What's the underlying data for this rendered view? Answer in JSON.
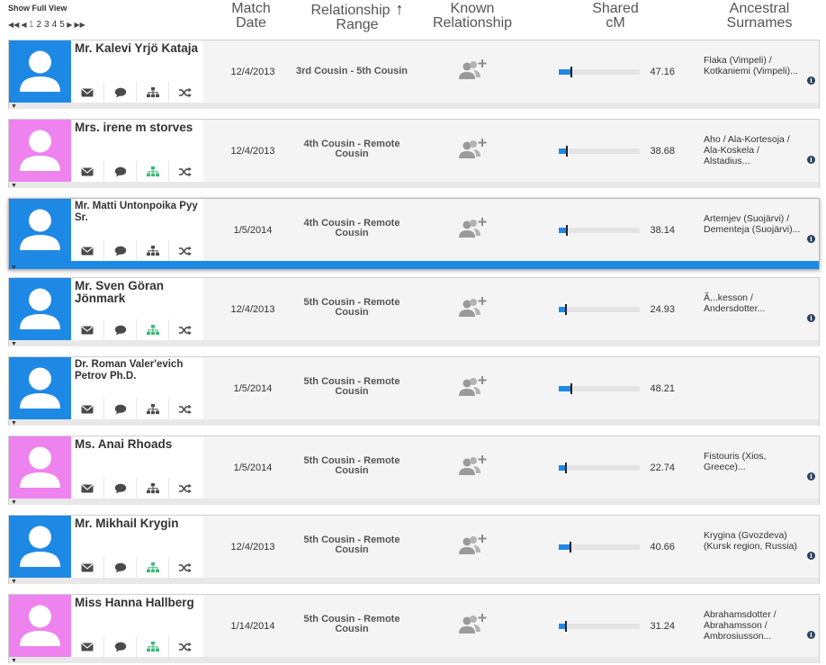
{
  "header": {
    "show_full_view": "Show Full View",
    "pager": {
      "first": "◀◀",
      "prev": "◀",
      "pages": [
        "1",
        "2",
        "3",
        "4",
        "5"
      ],
      "current": "1",
      "next": "▶",
      "last": "▶▶"
    },
    "columns": {
      "match_date": [
        "Match",
        "Date"
      ],
      "relationship_range": [
        "Relationship",
        "Range"
      ],
      "sort_arrow": "↑",
      "known_relationship": [
        "Known",
        "Relationship"
      ],
      "shared_cm": [
        "Shared",
        "cM"
      ],
      "ancestral_surnames": [
        "Ancestral",
        "Surnames"
      ]
    }
  },
  "colors": {
    "male_avatar": "#1e88e5",
    "female_avatar": "#ee82ee",
    "tree_active": "#3ab87a",
    "tree_inactive": "#4a4a4a",
    "accent": "#1e88e5"
  },
  "icons": {
    "message": "envelope-icon",
    "chat": "speech-bubble-icon",
    "tree": "family-tree-icon",
    "compare": "shuffle-icon",
    "add_relationship": "person-plus-icon",
    "info": "info-icon",
    "expand": "caret-down-icon"
  },
  "matches": [
    {
      "name": "Mr. Kalevi Yrjö Kataja",
      "gender": "male",
      "match_date": "12/4/2013",
      "relationship_range": "3rd Cousin - 5th Cousin",
      "shared_cm": "47.16",
      "shared_cm_fraction": 0.14,
      "surnames": "Flaka (Vimpeli) / Kotkaniemi (Vimpeli)...",
      "tree_active": false,
      "selected": false
    },
    {
      "name": "Mrs. irene m storves",
      "gender": "female",
      "match_date": "12/4/2013",
      "relationship_range": "4th Cousin - Remote Cousin",
      "shared_cm": "38.68",
      "shared_cm_fraction": 0.09,
      "surnames": "Aho / Ala-Kortesoja / Ala-Koskela / Alstadius...",
      "tree_active": true,
      "selected": false
    },
    {
      "name": "Mr. Matti Untonpoika Pyy Sr.",
      "gender": "male",
      "match_date": "1/5/2014",
      "relationship_range": "4th Cousin - Remote Cousin",
      "shared_cm": "38.14",
      "shared_cm_fraction": 0.09,
      "surnames": "Artemjev (Suojärvi) / Dementeja (Suojärvi)...",
      "tree_active": false,
      "selected": true
    },
    {
      "name": "Mr. Sven Göran Jönmark",
      "gender": "male",
      "match_date": "12/4/2013",
      "relationship_range": "5th Cousin - Remote Cousin",
      "shared_cm": "24.93",
      "shared_cm_fraction": 0.08,
      "surnames": "Ã...kesson / Andersdotter...",
      "tree_active": true,
      "selected": false
    },
    {
      "name": "Dr. Roman Valer'evich Petrov Ph.D.",
      "gender": "male",
      "match_date": "1/5/2014",
      "relationship_range": "5th Cousin - Remote Cousin",
      "shared_cm": "48.21",
      "shared_cm_fraction": 0.14,
      "surnames": "",
      "tree_active": false,
      "selected": false
    },
    {
      "name": "Ms. Anai Rhoads",
      "gender": "female",
      "match_date": "1/5/2014",
      "relationship_range": "5th Cousin - Remote Cousin",
      "shared_cm": "22.74",
      "shared_cm_fraction": 0.08,
      "surnames": "Fistouris (Xios, Greece)...",
      "tree_active": false,
      "selected": false
    },
    {
      "name": "Mr. Mikhail Krygin",
      "gender": "male",
      "match_date": "12/4/2013",
      "relationship_range": "5th Cousin - Remote Cousin",
      "shared_cm": "40.66",
      "shared_cm_fraction": 0.13,
      "surnames": "Krygina (Gvozdeva) (Kursk region, Russia)",
      "tree_active": true,
      "selected": false
    },
    {
      "name": "Miss Hanna Hallberg",
      "gender": "female",
      "match_date": "1/14/2014",
      "relationship_range": "5th Cousin - Remote Cousin",
      "shared_cm": "31.24",
      "shared_cm_fraction": 0.08,
      "surnames": "Abrahamsdotter / Abrahamsson / Ambrosiusson...",
      "tree_active": true,
      "selected": false
    }
  ]
}
